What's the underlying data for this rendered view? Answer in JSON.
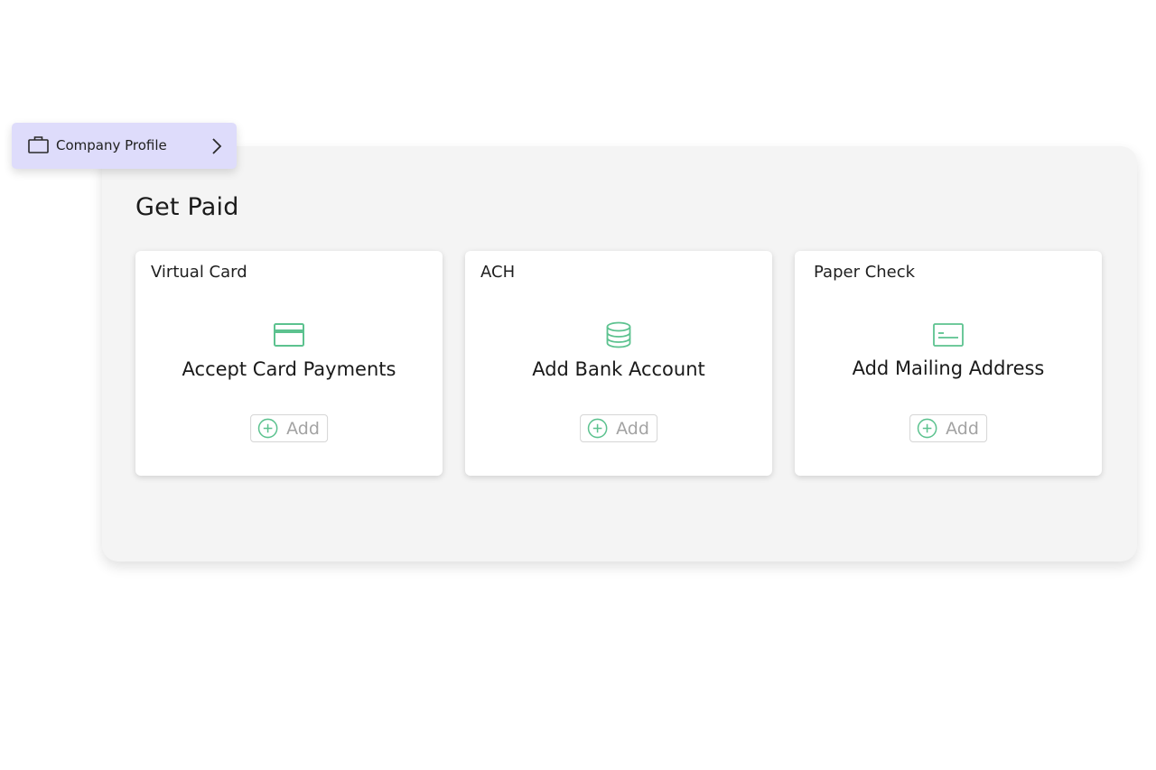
{
  "profile_pill": {
    "label": "Company Profile",
    "icon": "briefcase-icon",
    "chevron": "chevron-right-icon",
    "background": "#dedcfb"
  },
  "panel": {
    "title": "Get Paid"
  },
  "cards": [
    {
      "title": "Virtual Card",
      "icon": "credit-card-icon",
      "action_title": "Accept Card Payments",
      "add_label": "Add"
    },
    {
      "title": "ACH",
      "icon": "database-icon",
      "action_title": "Add Bank Account",
      "add_label": "Add"
    },
    {
      "title": "Paper Check",
      "icon": "check-document-icon",
      "action_title": "Add Mailing Address",
      "add_label": "Add"
    }
  ],
  "colors": {
    "accent_green": "#5cc28f",
    "panel_bg": "#f4f4f4",
    "muted_text": "#a3a3a3"
  }
}
